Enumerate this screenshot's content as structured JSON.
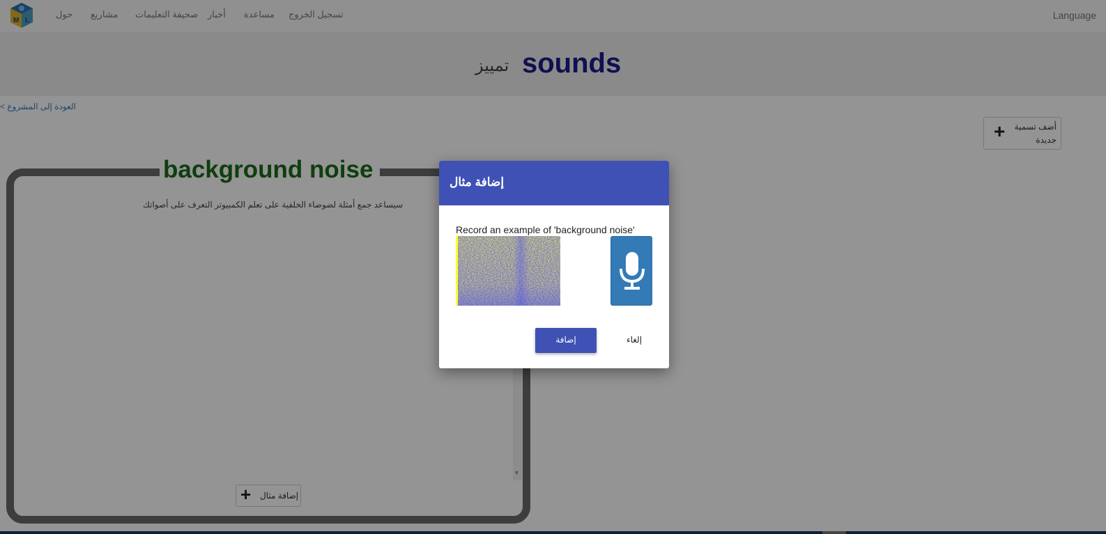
{
  "nav": {
    "links": [
      "حول",
      "مشاريع",
      "صحيفة التعليمات",
      "أخبار",
      "مساعدة",
      "تسجيل الخروج"
    ],
    "language": "Language",
    "logo_icon": "mbl-cube-logo-icon"
  },
  "header": {
    "project_name": "sounds",
    "project_type": "تمييز"
  },
  "back_link": "العودة إلى المشروع >",
  "new_label_button": {
    "icon": "plus-icon",
    "label": "أضف تسمية جديدة"
  },
  "bucket": {
    "label": "background noise",
    "description": "سيساعد جمع أمثلة لضوضاء الخلفية على تعلم الكمبيوتر التعرف على أصواتك",
    "add_example": {
      "icon": "plus-icon",
      "label": "إضافة مثال"
    }
  },
  "dialog": {
    "title": "إضافة مثال",
    "prompt": "Record an example of 'background noise'",
    "mic_icon": "microphone-icon",
    "add_label": "إضافة",
    "cancel_label": "إلغاء"
  },
  "colors": {
    "dialog_header": "#3f51b5",
    "mic_button": "#337ab7",
    "bucket_border": "#696969",
    "bucket_title": "#1b6b1b",
    "project_title": "#1a1a8c"
  }
}
